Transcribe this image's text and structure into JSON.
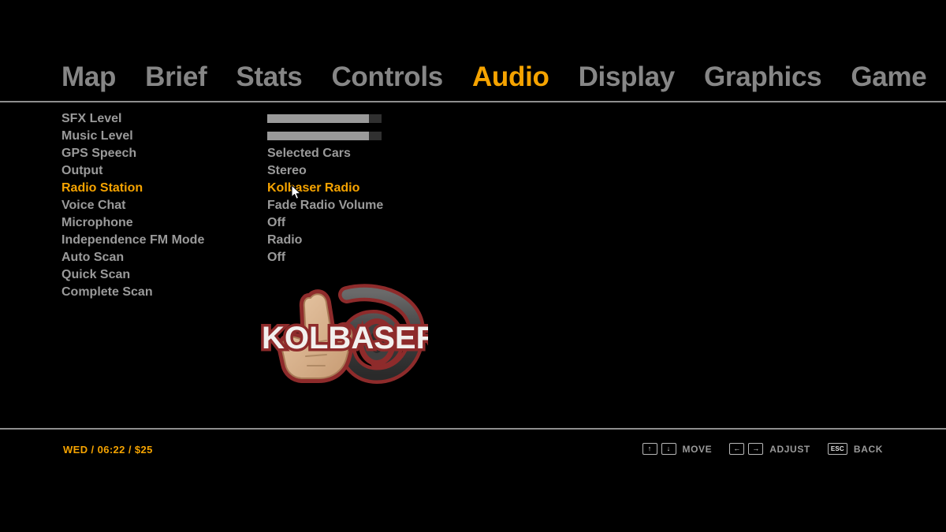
{
  "nav": {
    "items": [
      {
        "label": "Map",
        "active": false
      },
      {
        "label": "Brief",
        "active": false
      },
      {
        "label": "Stats",
        "active": false
      },
      {
        "label": "Controls",
        "active": false
      },
      {
        "label": "Audio",
        "active": true
      },
      {
        "label": "Display",
        "active": false
      },
      {
        "label": "Graphics",
        "active": false
      },
      {
        "label": "Game",
        "active": false
      }
    ]
  },
  "settings": {
    "rows": [
      {
        "label": "SFX Level",
        "type": "slider",
        "value": 89,
        "selected": false
      },
      {
        "label": "Music Level",
        "type": "slider",
        "value": 89,
        "selected": false
      },
      {
        "label": "GPS Speech",
        "type": "text",
        "value": "Selected Cars",
        "selected": false
      },
      {
        "label": "Output",
        "type": "text",
        "value": "Stereo",
        "selected": false
      },
      {
        "label": "Radio Station",
        "type": "text",
        "value": "Kolbaser Radio",
        "selected": true
      },
      {
        "label": "Voice Chat",
        "type": "text",
        "value": "Fade Radio Volume",
        "selected": false
      },
      {
        "label": "Microphone",
        "type": "text",
        "value": "Off",
        "selected": false
      },
      {
        "label": "Independence FM Mode",
        "type": "text",
        "value": "Radio",
        "selected": false
      },
      {
        "label": "Auto Scan",
        "type": "text",
        "value": "Off",
        "selected": false
      },
      {
        "label": "Quick Scan",
        "type": "text",
        "value": "",
        "selected": false
      },
      {
        "label": "Complete Scan",
        "type": "text",
        "value": "",
        "selected": false
      }
    ]
  },
  "logo": {
    "name": "kolbaser-radio-logo",
    "text": "KOLBASER",
    "outline_color": "#8e2b2b",
    "text_color": "#f2f0ee",
    "headphone_color": "#4a4a4a",
    "hand_color": "#d9b18c"
  },
  "status": {
    "text": "WED / 06:22 / $25",
    "day": "WED",
    "time": "06:22",
    "money": "$25"
  },
  "hints": [
    {
      "keys": [
        "↑",
        "↓"
      ],
      "label": "MOVE"
    },
    {
      "keys": [
        "←",
        "→"
      ],
      "label": "ADJUST"
    },
    {
      "keys": [
        "ESC"
      ],
      "label": "BACK"
    }
  ],
  "colors": {
    "accent": "#F5A300",
    "text": "#9a9a9a",
    "nav_text": "#868686",
    "background": "#000000",
    "rule": "#8e8e8e",
    "slider_fill": "#9a9a9a",
    "slider_track": "#303030"
  }
}
